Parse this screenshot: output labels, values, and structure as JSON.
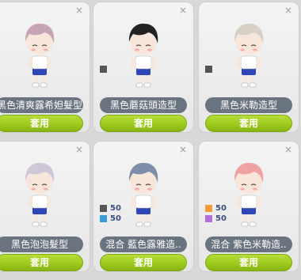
{
  "cards": [
    {
      "name": "黑色清爽露希妲髮型",
      "apply_label": "套用",
      "close_label": "×",
      "hair_color": "#c7a3b6",
      "swatches": []
    },
    {
      "name": "黑色蘑菇頭造型",
      "apply_label": "套用",
      "close_label": "×",
      "hair_color": "#222222",
      "swatches": [
        {
          "color": "#555555",
          "value": ""
        }
      ]
    },
    {
      "name": "黑色米勒造型",
      "apply_label": "套用",
      "close_label": "×",
      "hair_color": "#d8d0c6",
      "swatches": [
        {
          "color": "#555555",
          "value": ""
        }
      ]
    },
    {
      "name": "黑色泡泡髮型",
      "apply_label": "套用",
      "close_label": "×",
      "hair_color": "#cfc6da",
      "swatches": []
    },
    {
      "name": "混合 藍色露雅造..",
      "apply_label": "套用",
      "close_label": "×",
      "hair_color": "#7f8ea8",
      "swatches": [
        {
          "color": "#555555",
          "value": "50"
        },
        {
          "color": "#3a9ad9",
          "value": "50"
        }
      ]
    },
    {
      "name": "混合 紫色米勒造..",
      "apply_label": "套用",
      "close_label": "×",
      "hair_color": "#f0a2a2",
      "swatches": [
        {
          "color": "#f39c3a",
          "value": "50"
        },
        {
          "color": "#b46fd9",
          "value": "50"
        }
      ]
    }
  ]
}
